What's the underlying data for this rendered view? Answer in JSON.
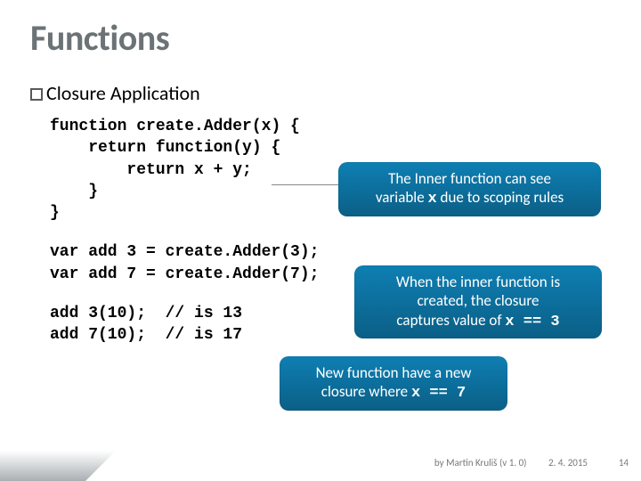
{
  "title": "Functions",
  "subtitle": {
    "label": "Closure",
    "rest": " Application"
  },
  "code": {
    "lines": [
      "function create.Adder(x) {",
      "    return function(y) {",
      "        return x + y;",
      "    }",
      "}",
      "",
      "var add 3 = create.Adder(3);",
      "var add 7 = create.Adder(7);",
      "",
      "add 3(10);  // is 13",
      "add 7(10);  // is 17"
    ]
  },
  "callouts": {
    "c1_a": "The Inner function can see",
    "c1_b_pre": "variable ",
    "c1_b_code": "x",
    "c1_b_post": " due to scoping rules",
    "c2_a": "When the inner function is",
    "c2_b": "created, the closure",
    "c2_c_pre": "captures value of ",
    "c2_c_code": "x == 3",
    "c3_a": "New function have a new",
    "c3_b_pre": "closure where ",
    "c3_b_code": "x == 7"
  },
  "footer": {
    "author": "by Martin Kruliš (v 1. 0)",
    "date": "2. 4. 2015",
    "page": "14"
  }
}
